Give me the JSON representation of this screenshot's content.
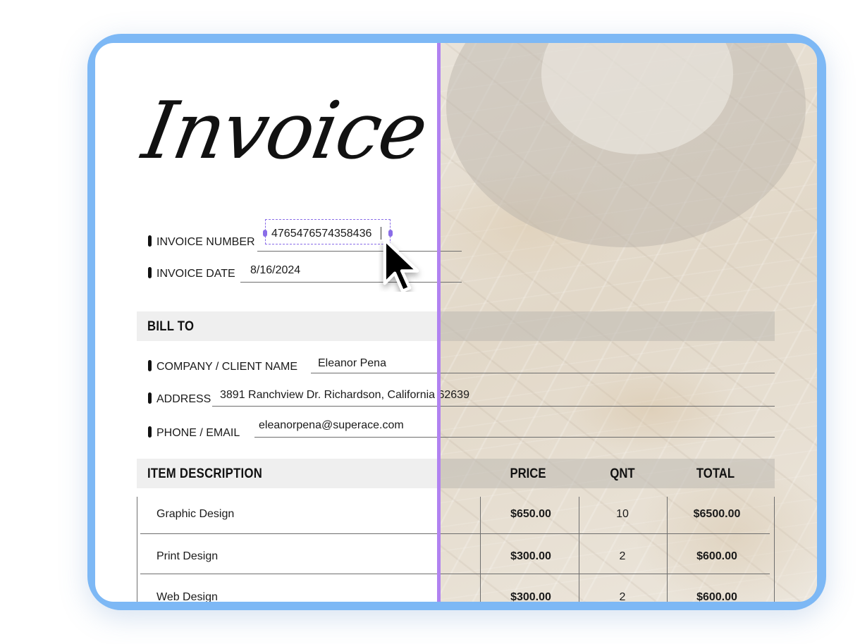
{
  "invoice": {
    "title": "Invoice",
    "number_label": "INVOICE NUMBER",
    "number_value": "4765476574358436",
    "date_label": "INVOICE DATE",
    "date_value": "8/16/2024"
  },
  "bill_to": {
    "heading": "BILL TO",
    "company_label": "COMPANY / CLIENT NAME",
    "company_value": "Eleanor Pena",
    "address_label": "ADDRESS",
    "address_value": "3891 Ranchview Dr. Richardson, California 62639",
    "contact_label": "PHONE / EMAIL",
    "contact_value": "eleanorpena@superace.com"
  },
  "items": {
    "headers": {
      "description": "ITEM DESCRIPTION",
      "price": "PRICE",
      "qnt": "QNT",
      "total": "TOTAL"
    },
    "rows": [
      {
        "description": "Graphic Design",
        "price": "$650.00",
        "qnt": "10",
        "total": "$6500.00"
      },
      {
        "description": "Print Design",
        "price": "$300.00",
        "qnt": "2",
        "total": "$600.00"
      },
      {
        "description": "Web Design",
        "price": "$300.00",
        "qnt": "2",
        "total": "$600.00"
      }
    ]
  },
  "colors": {
    "frame": "#7db8f5",
    "divider": "#b182f0",
    "selection": "#8a6de8"
  },
  "icons": [
    "cursor-arrow-icon"
  ]
}
